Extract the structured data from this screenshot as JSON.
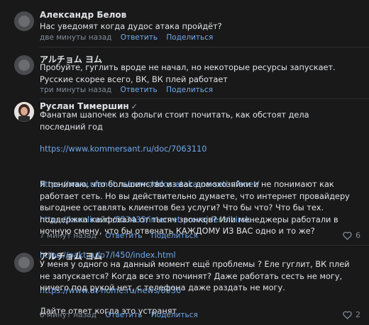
{
  "comments": [
    {
      "author": "Александр Белов",
      "text": "Нас уведомят когда дудос атака пройдёт?",
      "time": "две минуты назад",
      "reply": "Ответить",
      "share": "Поделиться"
    },
    {
      "author": "アルチョム ヨム",
      "text": "Пробуйте, гуглить вроде не начал, но некоторые ресурсы запускает. Русские скорее всего, ВК, ВК плей работает",
      "time": "три минуты назад",
      "reply": "Ответить",
      "share": "Поделиться"
    },
    {
      "author": "Руслан Тимершин",
      "verified": "✓",
      "intro": "Фанатам шапочек из фольги стоит почитать, как обстоят дела последний год",
      "links": [
        "https://www.kommersant.ru/doc/7063110",
        "https://www.ufanet.ru/news/ddos-ataka-na-seti-ufanet/",
        "https://ksonline.ru/553435/internet-provajder-sibirsk..",
        "https://pakt.ru/p7/l450/index.html",
        "https://www.at-home.ru/news/8936"
      ],
      "body": "Я понимаю, что большинство из вас домохозяйки и не понимают как работает сеть. Но вы действительно думаете, что интернет провайдеру выгоднее оставлять клиентов без услуги? Что бы что? Что бы тех. поддержка кайфовала от тысяч звонков? Или менеджеры работали в ночную смену, что бы отвечать КАЖДОМУ ИЗ ВАС одно и то же?",
      "time": "7 минут назад",
      "reply": "Ответить",
      "share": "Поделиться",
      "likes": "6"
    },
    {
      "author": "アルチョム ヨム",
      "text": "У меня у одного на данный момент ещё проблемы ? Еле гуглит, ВК плей не запускается? Когда все это починят? Даже работать сесть не могу, ничего под рукой нет, с телефона даже раздать не могу.\n\nДайте ответ когда это устранят",
      "time": "8 минут назад",
      "reply": "Ответить",
      "share": "Поделиться",
      "likes": "2"
    }
  ],
  "colors": {
    "link": "#71aaeb",
    "meta": "#818c99",
    "bg": "#19191a"
  }
}
